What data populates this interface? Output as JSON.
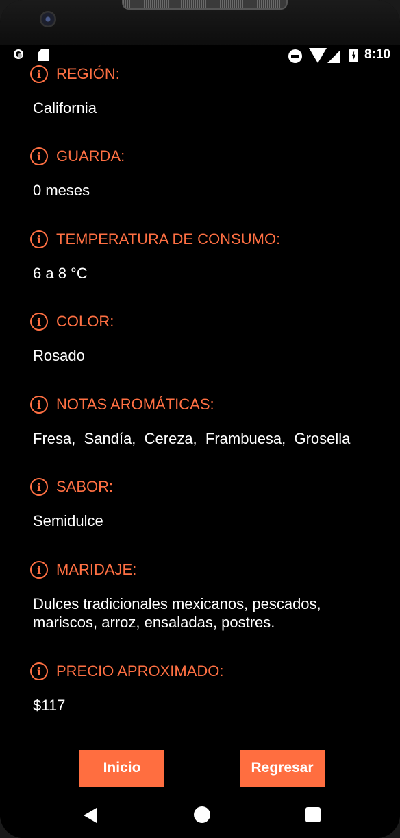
{
  "status_bar": {
    "time": "8:10"
  },
  "details": [
    {
      "label": "REGIÓN:",
      "value": "California"
    },
    {
      "label": "GUARDA:",
      "value": "0 meses"
    },
    {
      "label": "TEMPERATURA DE CONSUMO:",
      "value": "6 a 8 °C"
    },
    {
      "label": "COLOR:",
      "value": "Rosado"
    },
    {
      "label": "NOTAS AROMÁTICAS:",
      "value": "Fresa,  Sandía,  Cereza,  Frambuesa,  Grosella"
    },
    {
      "label": "SABOR:",
      "value": "Semidulce"
    },
    {
      "label": "MARIDAJE:",
      "value": "Dulces tradicionales mexicanos, pescados, mariscos, arroz, ensaladas, postres."
    },
    {
      "label": "PRECIO APROXIMADO:",
      "value": "$117"
    }
  ],
  "buttons": {
    "home": "Inicio",
    "back": "Regresar"
  },
  "icons": {
    "info": "info-circle-icon",
    "nav_back": "triangle-back-icon",
    "nav_home": "circle-home-icon",
    "nav_recent": "square-recent-icon"
  },
  "colors": {
    "accent": "#ff7043",
    "button": "#ff6e40",
    "background": "#000000",
    "text": "#ffffff"
  }
}
